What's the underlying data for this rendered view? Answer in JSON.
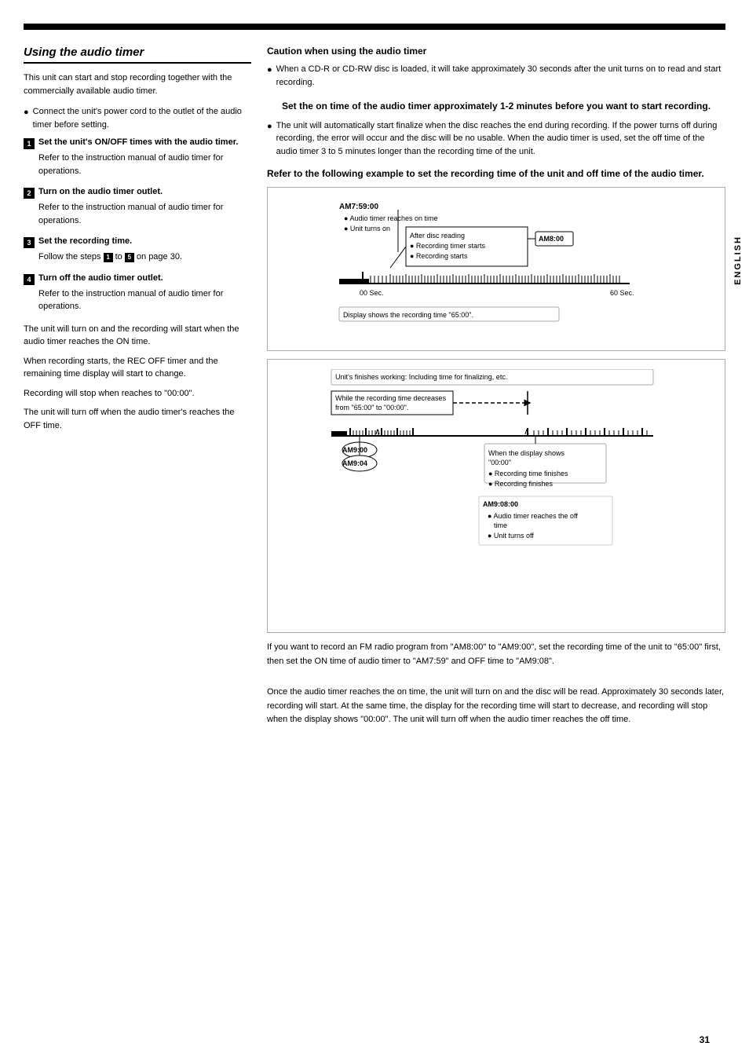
{
  "top_bar": true,
  "left_column": {
    "section_title": "Using the audio timer",
    "intro_text": "This unit can start and stop recording together with the commercially available audio timer.",
    "bullet1": "Connect the unit's power cord to the outlet of the audio timer before setting.",
    "steps": [
      {
        "num": "1",
        "header": "Set the unit's ON/OFF times with the audio timer.",
        "desc": "Refer to the instruction manual of audio timer for operations."
      },
      {
        "num": "2",
        "header": "Turn on the audio timer outlet.",
        "desc": "Refer to the instruction manual of audio timer for operations."
      },
      {
        "num": "3",
        "header": "Set the recording time.",
        "desc": "Follow the steps 1 to 5 on page 30."
      },
      {
        "num": "4",
        "header": "Turn off the audio timer outlet.",
        "desc": "Refer to the instruction manual of audio timer for operations."
      }
    ],
    "notes": [
      "The unit will turn on and the recording will start when the audio timer reaches the ON time.",
      "When recording starts, the REC OFF timer and the remaining time display will start to change.",
      "Recording will stop when reaches to \"00:00\".",
      "The unit will turn off when the audio timer's reaches the OFF time."
    ]
  },
  "right_column": {
    "caution_title": "Caution when using the audio timer",
    "caution_bullet": "When a CD-R or CD-RW disc is loaded, it will take approximately 30 seconds after the unit turns on to read and start recording.",
    "set_time_title": "Set the on time of the audio timer approximately 1-2 minutes before you want to start recording.",
    "set_time_bullet": "The unit will automatically start finalize when the disc reaches the end during recording. If the power turns off during recording, the error will occur and the disc will be no usable. When the audio timer is used, set the off time of the audio timer 3 to 5 minutes longer than the recording time of the unit.",
    "refer_title": "Refer to the following example to set the recording time of the unit and off time of the audio timer.",
    "diagram1": {
      "am_label": "AM7:59:00",
      "am_bullets": [
        "Audio timer reaches on time",
        "Unit turns on"
      ],
      "callout_label": "After disc reading",
      "callout_bullets": [
        "Recording timer starts",
        "Recording starts"
      ],
      "am800_label": "AM8:00",
      "sec_start": "00 Sec.",
      "sec_end": "60 Sec.",
      "display_label": "Display shows the recording time \"65:00\"."
    },
    "diagram2": {
      "unit_finish": "Unit's finishes working: Including time for finalizing, etc.",
      "while_label": "While the recording time decreases\nfrom \"65:00\" to \"00:00\".",
      "am900_label": "AM9:00",
      "am904_label": "AM9:04",
      "when_display": "When the display shows\n\"00:00\"",
      "when_bullets": [
        "Recording time finishes",
        "Recording finishes"
      ],
      "am908_label": "AM9:08:00",
      "am908_bullets": [
        "Audio timer reaches the off time",
        "Unit turns off"
      ]
    },
    "final_text1": "If you want to record an FM radio program from \"AM8:00\" to \"AM9:00\", set the recording time of the unit to \"65:00\" first, then set the ON time of audio timer to \"AM7:59\" and OFF time to \"AM9:08\".",
    "final_text2": "Once the audio timer reaches the on time, the unit will turn on and the disc will be read.  Approximately 30 seconds later, recording will start. At the same time, the display for the recording time will start to decrease, and recording will stop when the display shows \"00:00\". The unit will turn off when the audio timer reaches the off time."
  },
  "sidebar_label": "ENGLISH",
  "page_number": "31"
}
